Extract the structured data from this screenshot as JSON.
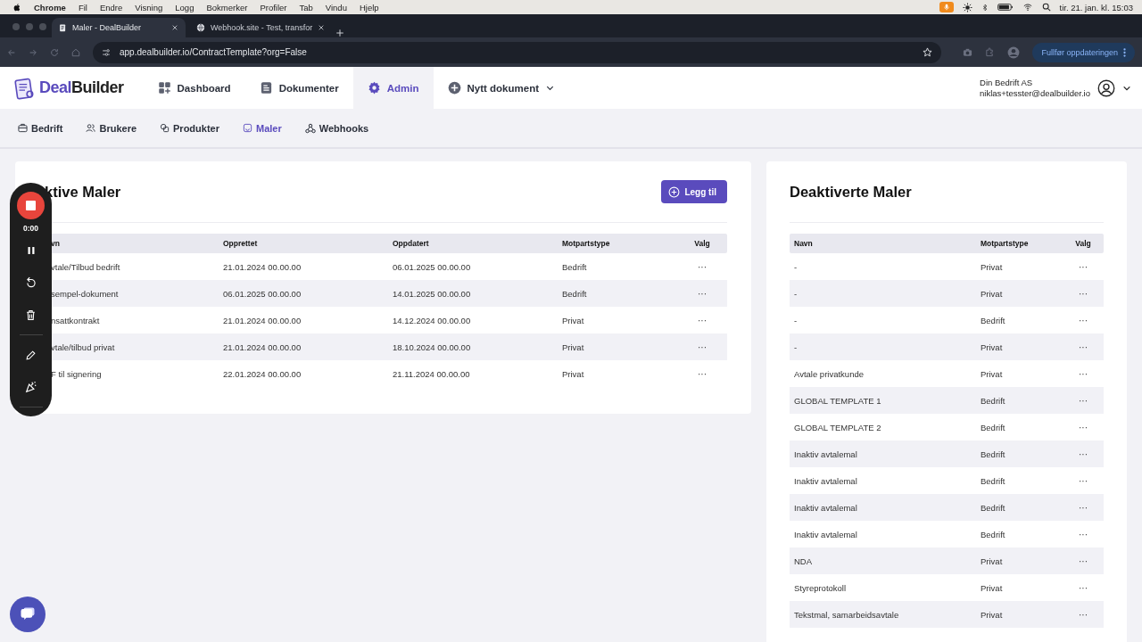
{
  "menu_bar": {
    "app": "Chrome",
    "items": [
      "Fil",
      "Endre",
      "Visning",
      "Logg",
      "Bokmerker",
      "Profiler",
      "Tab",
      "Vindu",
      "Hjelp"
    ],
    "clock": "tir. 21. jan. kl. 15:03"
  },
  "browser": {
    "tabs": [
      {
        "title": "Maler - DealBuilder",
        "selected": true
      },
      {
        "title": "Webhook.site - Test, transfor",
        "selected": false
      }
    ],
    "url": "app.dealbuilder.io/ContractTemplate?org=False",
    "update_button": "Fullfør oppdateringen"
  },
  "logo": {
    "accent": "Deal",
    "rest": "Builder"
  },
  "nav": [
    {
      "label": "Dashboard",
      "selected": false
    },
    {
      "label": "Dokumenter",
      "selected": false
    },
    {
      "label": "Admin",
      "selected": true
    },
    {
      "label": "Nytt dokument",
      "selected": false
    }
  ],
  "account": {
    "company": "Din Bedrift AS",
    "email": "niklas+tesster@dealbuilder.io"
  },
  "subnav": [
    {
      "label": "Bedrift",
      "selected": false
    },
    {
      "label": "Brukere",
      "selected": false
    },
    {
      "label": "Produkter",
      "selected": false
    },
    {
      "label": "Maler",
      "selected": true
    },
    {
      "label": "Webhooks",
      "selected": false
    }
  ],
  "active_templates": {
    "title": "ktive Maler",
    "add_button": "Legg til",
    "columns": [
      "vn",
      "Opprettet",
      "Oppdatert",
      "Motpartstype",
      "Valg"
    ],
    "rows": [
      {
        "name": "vtale/Tilbud bedrift",
        "created": "21.01.2024 00.00.00",
        "updated": "06.01.2025 00.00.00",
        "party": "Bedrift",
        "menu": "···"
      },
      {
        "name": "sempel-dokument",
        "created": "06.01.2025 00.00.00",
        "updated": "14.01.2025 00.00.00",
        "party": "Bedrift",
        "menu": "···"
      },
      {
        "name": "nsattkontrakt",
        "created": "21.01.2024 00.00.00",
        "updated": "14.12.2024 00.00.00",
        "party": "Privat",
        "menu": "···"
      },
      {
        "name": "vtale/tilbud privat",
        "created": "21.01.2024 00.00.00",
        "updated": "18.10.2024 00.00.00",
        "party": "Privat",
        "menu": "···"
      },
      {
        "name": "F til signering",
        "created": "22.01.2024 00.00.00",
        "updated": "21.11.2024 00.00.00",
        "party": "Privat",
        "menu": "···"
      }
    ]
  },
  "deactivated_templates": {
    "title": "Deaktiverte Maler",
    "columns": [
      "Navn",
      "Motpartstype",
      "Valg"
    ],
    "rows": [
      {
        "name": "-",
        "party": "Privat",
        "menu": "···"
      },
      {
        "name": "-",
        "party": "Privat",
        "menu": "···"
      },
      {
        "name": "-",
        "party": "Bedrift",
        "menu": "···"
      },
      {
        "name": "-",
        "party": "Privat",
        "menu": "···"
      },
      {
        "name": "Avtale privatkunde",
        "party": "Privat",
        "menu": "···"
      },
      {
        "name": "GLOBAL TEMPLATE 1",
        "party": "Bedrift",
        "menu": "···"
      },
      {
        "name": "GLOBAL TEMPLATE 2",
        "party": "Bedrift",
        "menu": "···"
      },
      {
        "name": "Inaktiv avtalemal",
        "party": "Bedrift",
        "menu": "···"
      },
      {
        "name": "Inaktiv avtalemal",
        "party": "Bedrift",
        "menu": "···"
      },
      {
        "name": "Inaktiv avtalemal",
        "party": "Bedrift",
        "menu": "···"
      },
      {
        "name": "Inaktiv avtalemal",
        "party": "Bedrift",
        "menu": "···"
      },
      {
        "name": "NDA",
        "party": "Privat",
        "menu": "···"
      },
      {
        "name": "Styreprotokoll",
        "party": "Privat",
        "menu": "···"
      },
      {
        "name": "Tekstmal, samarbeidsavtale",
        "party": "Privat",
        "menu": "···"
      }
    ]
  },
  "recorder": {
    "time": "0:00"
  }
}
